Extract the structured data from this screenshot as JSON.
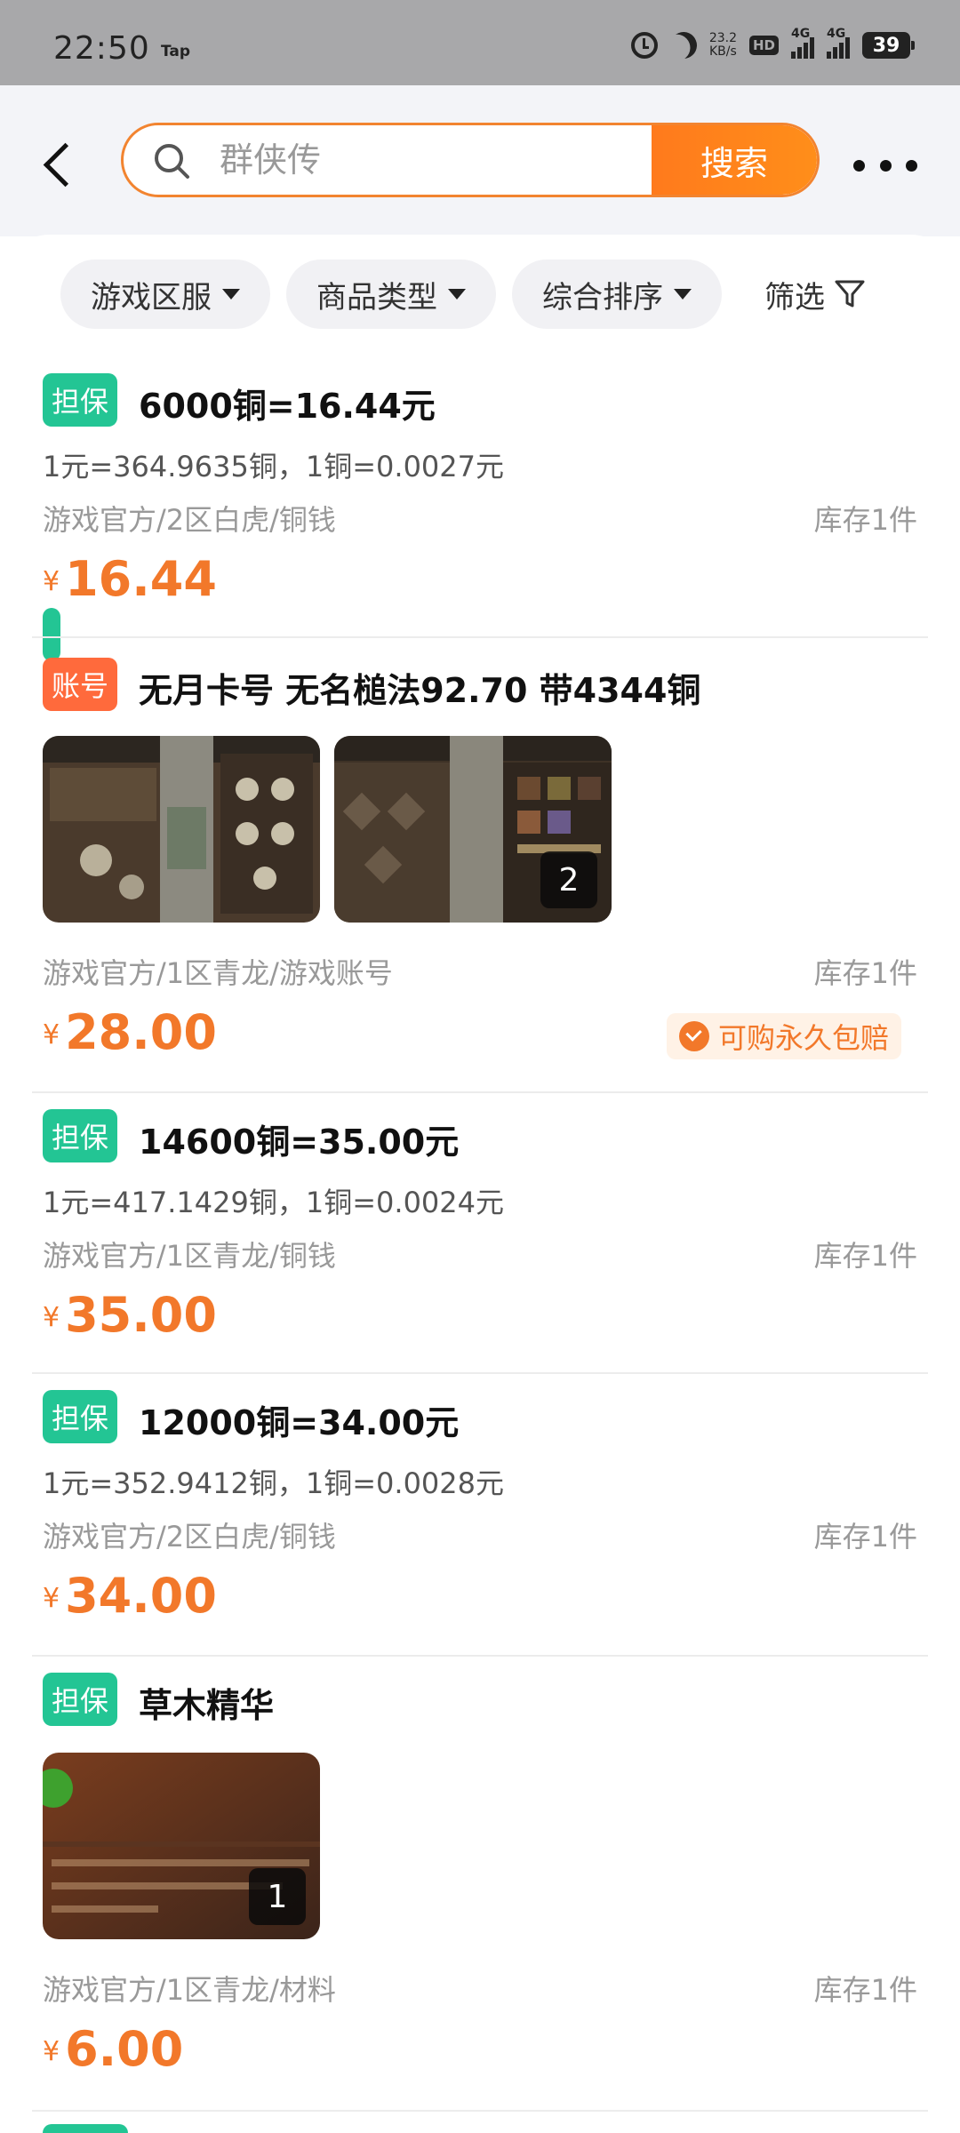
{
  "status_bar": {
    "time": "22:50",
    "app_badge": "Tap",
    "net_speed_value": "23.2",
    "net_speed_unit": "KB/s",
    "hd_label": "HD",
    "sim1_label": "4G",
    "sim2_label": "4G",
    "battery": "39"
  },
  "search": {
    "placeholder": "群侠传",
    "button_label": "搜索"
  },
  "filters": {
    "server": "游戏区服",
    "goods_type": "商品类型",
    "sort": "综合排序",
    "filter": "筛选"
  },
  "items": [
    {
      "tag": "担保",
      "title": "6000铜=16.44元",
      "rate": "1元=364.9635铜，1铜=0.0027元",
      "path": "游戏官方/2区白虎/铜钱",
      "stock": "库存1件",
      "currency": "¥",
      "price": "16.44"
    },
    {
      "tag": "账号",
      "title": "无月卡号 无名槌法92.70  带4344铜",
      "image_count": "2",
      "path": "游戏官方/1区青龙/游戏账号",
      "stock": "库存1件",
      "currency": "¥",
      "price": "28.00",
      "badge": "可购永久包赔"
    },
    {
      "tag": "担保",
      "title": "14600铜=35.00元",
      "rate": "1元=417.1429铜，1铜=0.0024元",
      "path": "游戏官方/1区青龙/铜钱",
      "stock": "库存1件",
      "currency": "¥",
      "price": "35.00"
    },
    {
      "tag": "担保",
      "title": "12000铜=34.00元",
      "rate": "1元=352.9412铜，1铜=0.0028元",
      "path": "游戏官方/2区白虎/铜钱",
      "stock": "库存1件",
      "currency": "¥",
      "price": "34.00"
    },
    {
      "tag": "担保",
      "title": "草木精华",
      "image_count": "1",
      "path": "游戏官方/1区青龙/材料",
      "stock": "库存1件",
      "currency": "¥",
      "price": "6.00"
    }
  ],
  "colors": {
    "accent": "#f2782a",
    "tag_green": "#23c594",
    "tag_orange": "#ff6a3c",
    "header_bg": "#f3f4f8",
    "status_bar_bg": "#a8a8aa"
  },
  "icons": [
    "back-icon",
    "search-icon",
    "more-icon",
    "caret-down-icon",
    "filter-funnel-icon",
    "check-circle-icon",
    "alarm-icon",
    "moon-icon",
    "signal-icon",
    "battery-icon"
  ]
}
